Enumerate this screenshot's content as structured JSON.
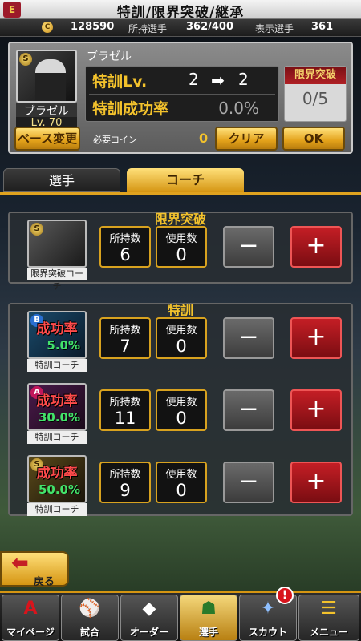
{
  "title": "特訓/限界突破/継承",
  "stats": {
    "coins": "128590",
    "owned_label": "所持選手",
    "owned_value": "362/400",
    "display_label": "表示選手",
    "display_value": "361"
  },
  "player": {
    "name": "ブラゼル",
    "level": "Lv. 70",
    "training_lv_label": "特訓Lv.",
    "lv_from": "2",
    "lv_to": "2",
    "success_label": "特訓成功率",
    "success_value": "0.0%",
    "limit_label": "限界突破",
    "limit_value": "0/5",
    "base_change": "ベース変更",
    "required_coin_label": "必要コイン",
    "required_coin_value": "0",
    "clear": "クリア",
    "ok": "OK"
  },
  "tabs": [
    "選手",
    "コーチ"
  ],
  "sections": {
    "limit": {
      "title": "限界突破",
      "items": [
        {
          "rank": "S",
          "caption": "限界突破コーチ",
          "owned_label": "所持数",
          "owned": "6",
          "used_label": "使用数",
          "used": "0"
        }
      ]
    },
    "training": {
      "title": "特訓",
      "items": [
        {
          "rank": "B",
          "rate_title": "成功率",
          "rate": "5.0%",
          "caption": "特訓コーチ",
          "owned_label": "所持数",
          "owned": "7",
          "used_label": "使用数",
          "used": "0"
        },
        {
          "rank": "A",
          "rate_title": "成功率",
          "rate": "30.0%",
          "caption": "特訓コーチ",
          "owned_label": "所持数",
          "owned": "11",
          "used_label": "使用数",
          "used": "0"
        },
        {
          "rank": "S",
          "rate_title": "成功率",
          "rate": "50.0%",
          "caption": "特訓コーチ",
          "owned_label": "所持数",
          "owned": "9",
          "used_label": "使用数",
          "used": "0"
        }
      ]
    }
  },
  "back": "戻る",
  "nav": [
    "マイページ",
    "試合",
    "オーダー",
    "選手",
    "スカウト",
    "メニュー"
  ],
  "nav_badge": "!",
  "colors": {
    "gold": "#f3c22c",
    "red": "#c41e25"
  }
}
